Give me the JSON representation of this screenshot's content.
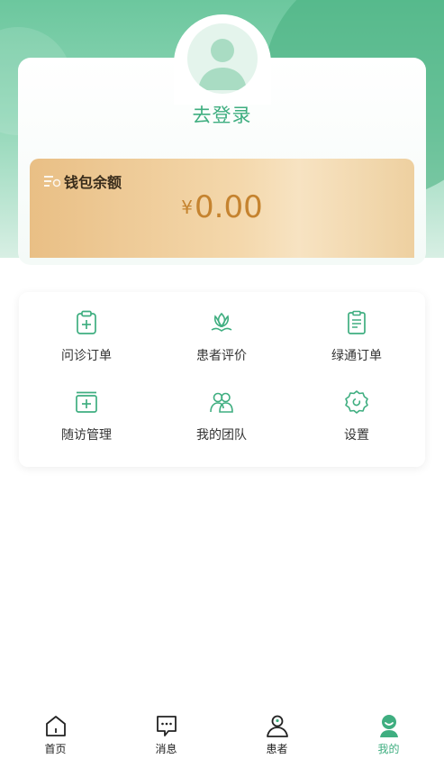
{
  "profile": {
    "login_label": "去登录"
  },
  "wallet": {
    "title": "钱包余额",
    "currency": "¥",
    "amount": "0.00"
  },
  "menu": {
    "items": [
      {
        "label": "问诊订单",
        "icon": "clipboard-plus-icon"
      },
      {
        "label": "患者评价",
        "icon": "lotus-icon"
      },
      {
        "label": "绿通订单",
        "icon": "document-list-icon"
      },
      {
        "label": "随访管理",
        "icon": "medical-kit-icon"
      },
      {
        "label": "我的团队",
        "icon": "team-icon"
      },
      {
        "label": "设置",
        "icon": "gear-icon"
      }
    ]
  },
  "tabbar": {
    "items": [
      {
        "label": "首页",
        "icon": "home-icon"
      },
      {
        "label": "消息",
        "icon": "message-icon"
      },
      {
        "label": "患者",
        "icon": "patient-icon"
      },
      {
        "label": "我的",
        "icon": "profile-icon",
        "active": true
      }
    ]
  },
  "colors": {
    "accent": "#3fae80",
    "wallet_amount": "#c5832f",
    "hero_green": "#6cc79e"
  }
}
